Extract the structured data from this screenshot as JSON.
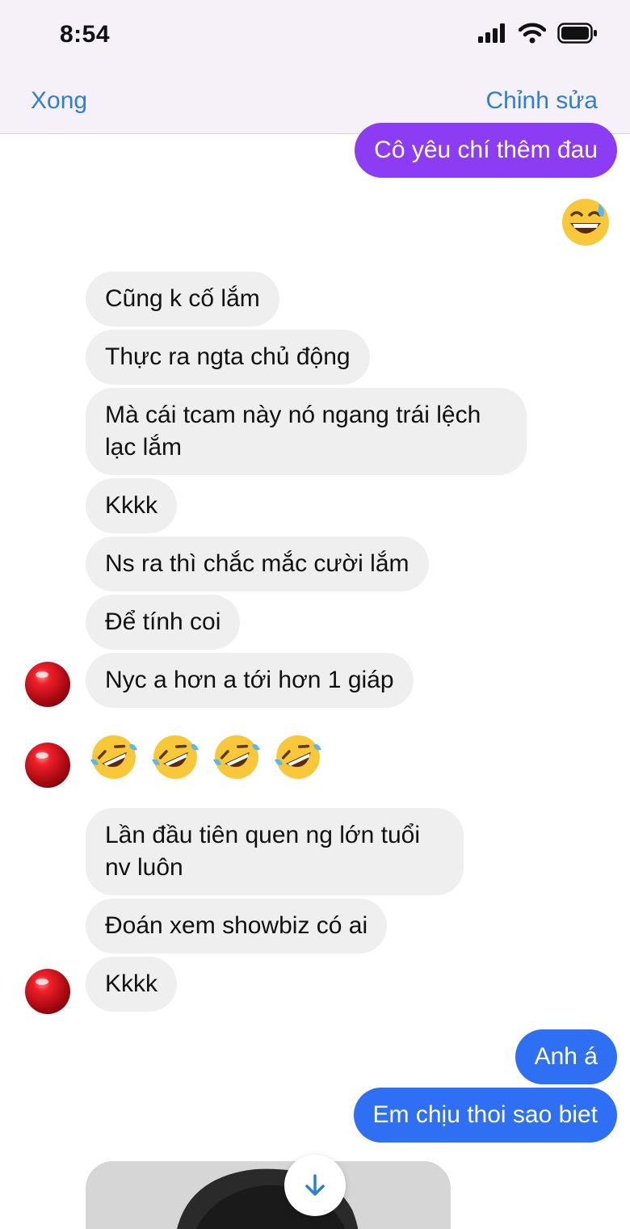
{
  "status_bar": {
    "time": "8:54",
    "icons": [
      "signal-icon",
      "wifi-icon",
      "battery-icon"
    ]
  },
  "nav": {
    "left_label": "Xong",
    "right_label": "Chỉnh sửa"
  },
  "messages": {
    "m0": "Cô yêu chí thêm đau",
    "m2": "Cũng k cố lắm",
    "m3": "Thực ra ngta chủ động",
    "m4": "Mà cái tcam này nó ngang trái lệch lạc lắm",
    "m5": "Kkkk",
    "m6": "Ns ra thì chắc mắc cười lắm",
    "m7": "Để tính coi",
    "m8": "Nyc a hơn a tới hơn 1 giáp",
    "m10": "Lần đầu tiên quen ng lớn tuổi nv luôn",
    "m11": "Đoán xem showbiz có ai",
    "m12": "Kkkk",
    "m13": "Anh á",
    "m14": "Em chịu thoi sao biet"
  },
  "reactions": {
    "sweat_smile": "sweat-smile-emoji",
    "rofl": [
      "rofl-emoji",
      "rofl-emoji",
      "rofl-emoji",
      "rofl-emoji"
    ]
  },
  "colors": {
    "accent": "#2d7fd6",
    "outgoing_purple": "#8c3cf2",
    "outgoing_blue": "#2f6ff4",
    "incoming": "#efefef",
    "avatar": "#d8101a"
  }
}
